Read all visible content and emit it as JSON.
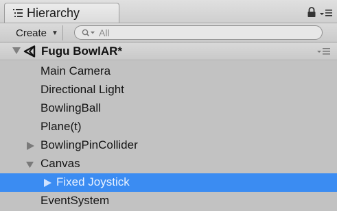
{
  "tab": {
    "title": "Hierarchy"
  },
  "toolbar": {
    "create_label": "Create",
    "search_placeholder": "All"
  },
  "scene": {
    "name": "Fugu BowlAR*"
  },
  "items": [
    {
      "label": "Main Camera"
    },
    {
      "label": "Directional Light"
    },
    {
      "label": "BowlingBall"
    },
    {
      "label": "Plane(t)"
    },
    {
      "label": "BowlingPinCollider",
      "expander": "collapsed"
    },
    {
      "label": "Canvas",
      "expander": "expanded"
    },
    {
      "label": "Fixed Joystick",
      "expander": "collapsed",
      "selected": true
    },
    {
      "label": "EventSystem"
    }
  ],
  "colors": {
    "selection": "#3b8cf2",
    "panel_background": "#c2c2c2"
  }
}
